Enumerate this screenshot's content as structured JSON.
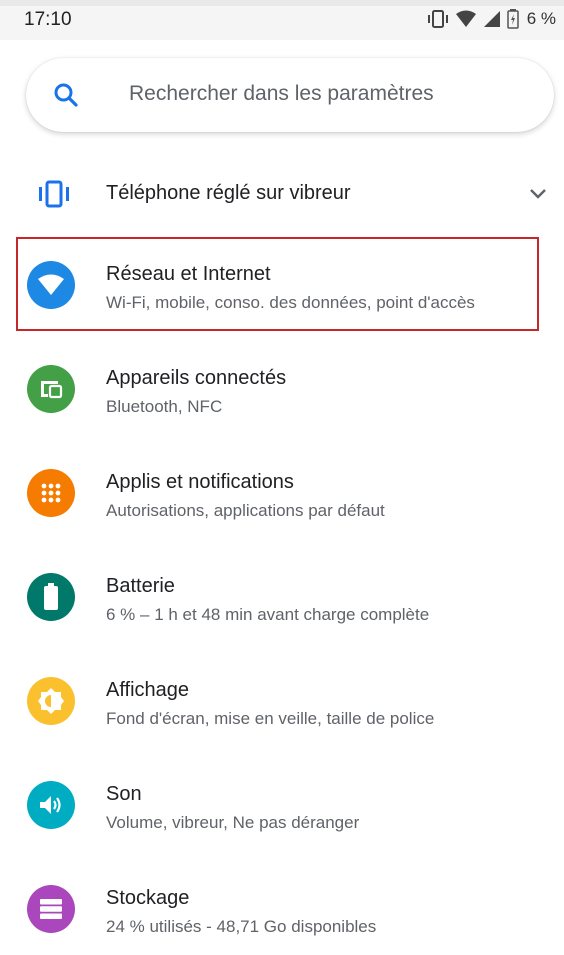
{
  "status_bar": {
    "time": "17:10",
    "battery_text": "6 %"
  },
  "search": {
    "placeholder": "Rechercher dans les paramètres",
    "icon": "search-icon"
  },
  "condition": {
    "label": "Téléphone réglé sur vibreur",
    "icon": "vibrate-icon"
  },
  "settings": [
    {
      "title": "Réseau et Internet",
      "subtitle": "Wi-Fi, mobile, conso. des données, point d'accès",
      "icon": "wifi-icon",
      "color": "#1e88e5",
      "highlighted": true
    },
    {
      "title": "Appareils connectés",
      "subtitle": "Bluetooth, NFC",
      "icon": "devices-icon",
      "color": "#43a047"
    },
    {
      "title": "Applis et notifications",
      "subtitle": "Autorisations, applications par défaut",
      "icon": "apps-grid-icon",
      "color": "#f57c00"
    },
    {
      "title": "Batterie",
      "subtitle": "6 % – 1 h et 48 min avant charge complète",
      "icon": "battery-icon",
      "color": "#00796b"
    },
    {
      "title": "Affichage",
      "subtitle": "Fond d'écran, mise en veille, taille de police",
      "icon": "brightness-icon",
      "color": "#fbc02d"
    },
    {
      "title": "Son",
      "subtitle": "Volume, vibreur, Ne pas déranger",
      "icon": "volume-icon",
      "color": "#00acc1"
    },
    {
      "title": "Stockage",
      "subtitle": "24 % utilisés - 48,71 Go disponibles",
      "icon": "storage-icon",
      "color": "#ab47bc"
    }
  ]
}
